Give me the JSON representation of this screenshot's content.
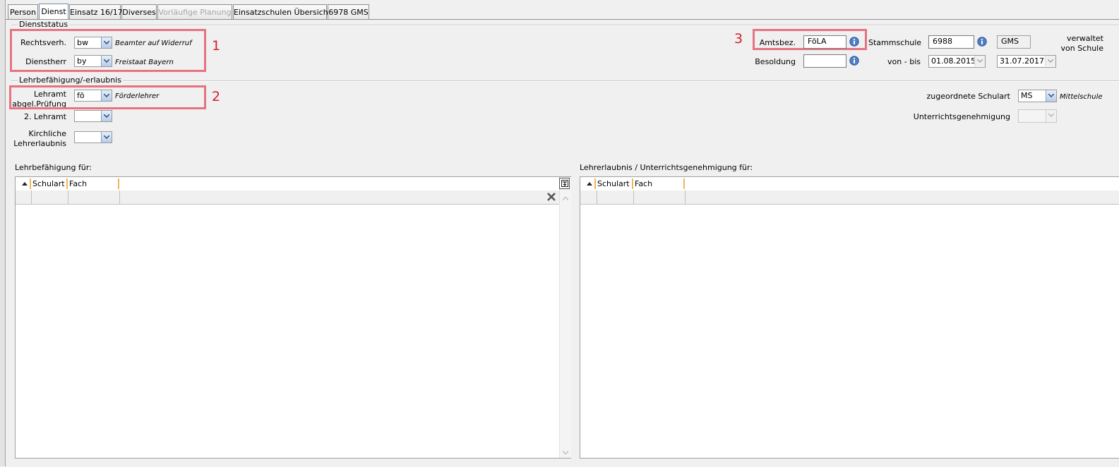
{
  "tabs": [
    {
      "label": "Person",
      "state": "normal"
    },
    {
      "label": "Dienst",
      "state": "active"
    },
    {
      "label": "Einsatz 16/17",
      "state": "normal"
    },
    {
      "label": "Diverses",
      "state": "normal"
    },
    {
      "label": "Vorläufige Planung",
      "state": "disabled"
    },
    {
      "label": "Einsatzschulen Übersicht",
      "state": "normal"
    },
    {
      "label": "6978 GMS",
      "state": "normal"
    }
  ],
  "dienststatus": {
    "title": "Dienststatus",
    "rechtsverh": {
      "label": "Rechtsverh.",
      "value": "bw",
      "description": "Beamter auf Widerruf"
    },
    "dienstherr": {
      "label": "Dienstherr",
      "value": "by",
      "description": "Freistaat Bayern"
    },
    "amtsbez": {
      "label": "Amtsbez.",
      "value": "FöLA"
    },
    "besoldung": {
      "label": "Besoldung",
      "value": ""
    },
    "stammschule": {
      "label": "Stammschule",
      "value": "6988",
      "type": "GMS"
    },
    "von_bis": {
      "label": "von - bis",
      "from": "01.08.2015",
      "to": "31.07.2017"
    },
    "verwaltet": {
      "line1": "verwaltet",
      "line2": "von Schule"
    }
  },
  "lehrbefaehigung": {
    "title": "Lehrbefähigung/-erlaubnis",
    "lehramt": {
      "label_line1": "Lehramt",
      "label_line2": "abgel.Prüfung",
      "value": "fö",
      "description": "Förderlehrer"
    },
    "lehramt2": {
      "label": "2. Lehramt",
      "value": ""
    },
    "kirchliche": {
      "label_line1": "Kirchliche",
      "label_line2": "Lehrerlaubnis",
      "value": ""
    },
    "schulart": {
      "label": "zugeordnete Schulart",
      "value": "MS",
      "description": "Mittelschule"
    },
    "unterrichtsgenehmigung": {
      "label": "Unterrichtsgenehmigung",
      "value": ""
    }
  },
  "annotations": {
    "n1": "1",
    "n2": "2",
    "n3": "3"
  },
  "grid_left": {
    "title": "Lehrbefähigung für:",
    "columns": [
      "Schulart",
      "Fach"
    ]
  },
  "grid_right": {
    "title": "Lehrerlaubnis / Unterrichtsgenehmigung für:",
    "columns": [
      "Schulart",
      "Fach"
    ]
  },
  "colors": {
    "annotation_box": "#e57480",
    "annotation_number": "#d3202a",
    "sort_separator": "#f0b55a"
  }
}
